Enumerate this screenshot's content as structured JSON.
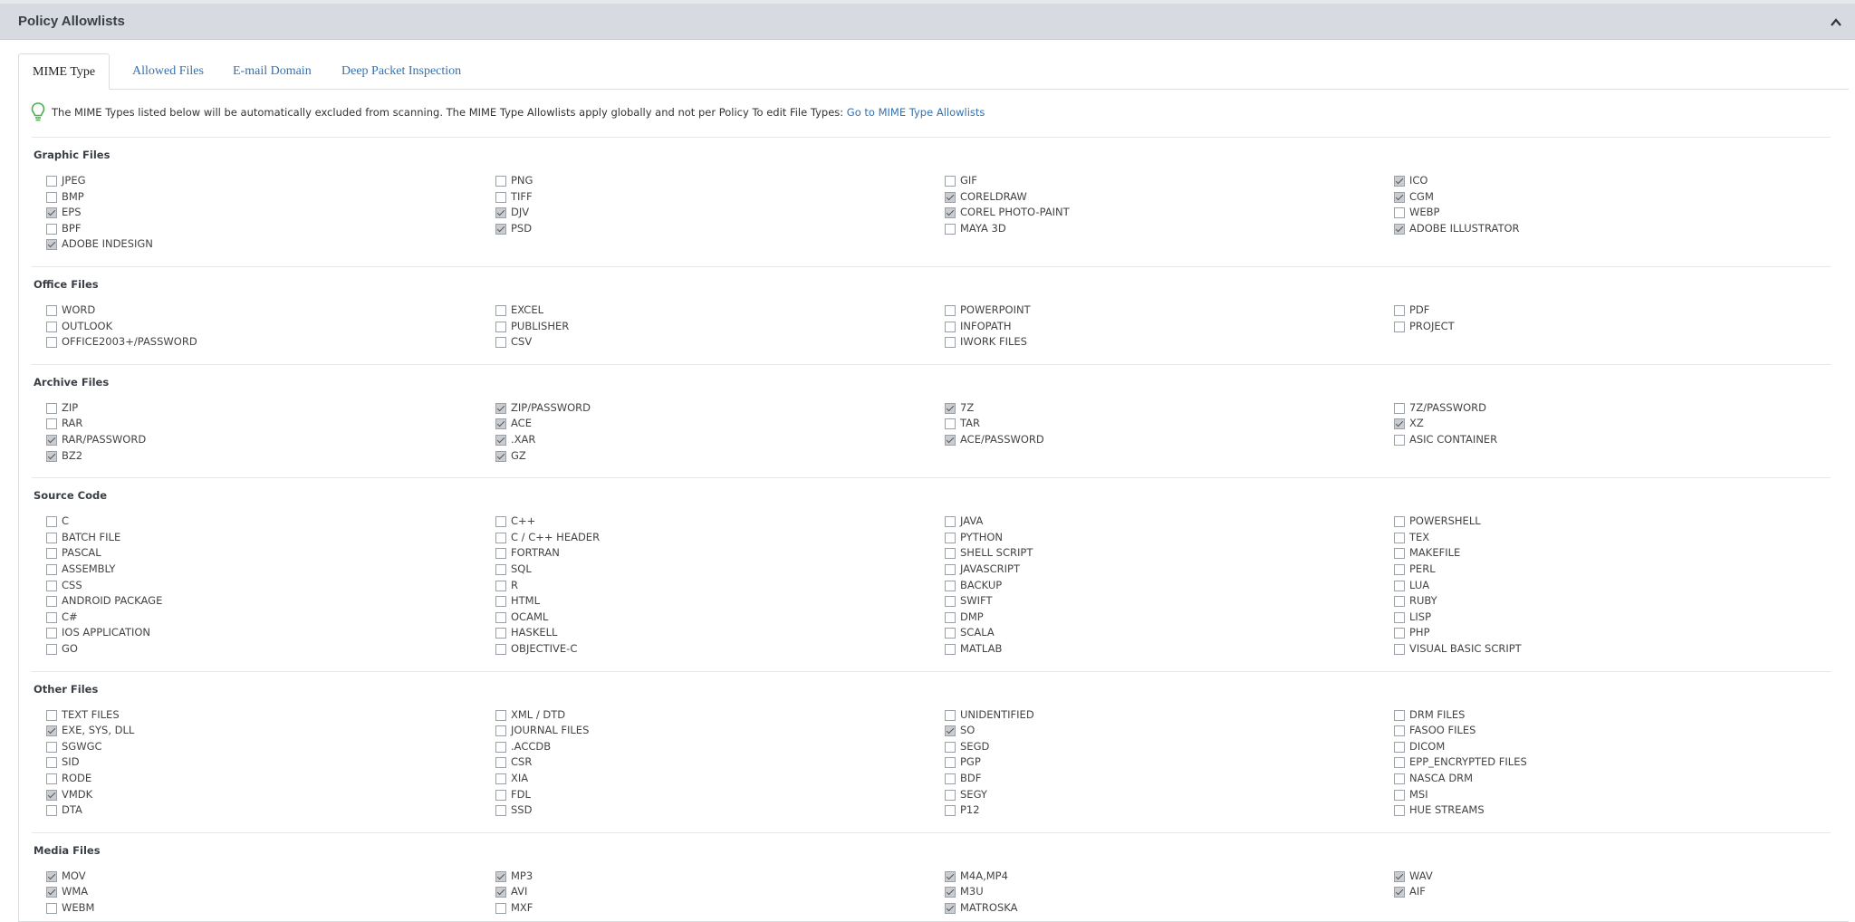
{
  "header": {
    "title": "Policy Allowlists",
    "collapse_icon": "chevron-up-icon"
  },
  "tabs": [
    "MIME Type",
    "Allowed Files",
    "E-mail Domain",
    "Deep Packet Inspection"
  ],
  "info": {
    "text": "The MIME Types listed below will be automatically excluded from scanning. The MIME Type Allowlists apply globally and not per Policy To edit File Types: ",
    "link": "Go to MIME Type Allowlists",
    "icon": "lightbulb-icon"
  },
  "sections": [
    {
      "title": "Graphic Files",
      "items": [
        {
          "label": "JPEG",
          "checked": false
        },
        {
          "label": "PNG",
          "checked": false
        },
        {
          "label": "GIF",
          "checked": false
        },
        {
          "label": "ICO",
          "checked": true
        },
        {
          "label": "BMP",
          "checked": false
        },
        {
          "label": "TIFF",
          "checked": false
        },
        {
          "label": "CORELDRAW",
          "checked": true
        },
        {
          "label": "CGM",
          "checked": true
        },
        {
          "label": "EPS",
          "checked": true
        },
        {
          "label": "DJV",
          "checked": true
        },
        {
          "label": "COREL PHOTO-PAINT",
          "checked": true
        },
        {
          "label": "WEBP",
          "checked": false
        },
        {
          "label": "BPF",
          "checked": false
        },
        {
          "label": "PSD",
          "checked": true
        },
        {
          "label": "MAYA 3D",
          "checked": false
        },
        {
          "label": "ADOBE ILLUSTRATOR",
          "checked": true
        },
        {
          "label": "ADOBE INDESIGN",
          "checked": true
        }
      ]
    },
    {
      "title": "Office Files",
      "items": [
        {
          "label": "WORD",
          "checked": false
        },
        {
          "label": "EXCEL",
          "checked": false
        },
        {
          "label": "POWERPOINT",
          "checked": false
        },
        {
          "label": "PDF",
          "checked": false
        },
        {
          "label": "OUTLOOK",
          "checked": false
        },
        {
          "label": "PUBLISHER",
          "checked": false
        },
        {
          "label": "INFOPATH",
          "checked": false
        },
        {
          "label": "PROJECT",
          "checked": false
        },
        {
          "label": "OFFICE2003+/PASSWORD",
          "checked": false
        },
        {
          "label": "CSV",
          "checked": false
        },
        {
          "label": "IWORK FILES",
          "checked": false
        }
      ]
    },
    {
      "title": "Archive Files",
      "items": [
        {
          "label": "ZIP",
          "checked": false
        },
        {
          "label": "ZIP/PASSWORD",
          "checked": true
        },
        {
          "label": "7Z",
          "checked": true
        },
        {
          "label": "7Z/PASSWORD",
          "checked": false
        },
        {
          "label": "RAR",
          "checked": false
        },
        {
          "label": "ACE",
          "checked": true
        },
        {
          "label": "TAR",
          "checked": false
        },
        {
          "label": "XZ",
          "checked": true
        },
        {
          "label": "RAR/PASSWORD",
          "checked": true
        },
        {
          "label": ".XAR",
          "checked": true
        },
        {
          "label": "ACE/PASSWORD",
          "checked": true
        },
        {
          "label": "ASIC CONTAINER",
          "checked": false
        },
        {
          "label": "BZ2",
          "checked": true
        },
        {
          "label": "GZ",
          "checked": true
        }
      ]
    },
    {
      "title": "Source Code",
      "items": [
        {
          "label": "C",
          "checked": false
        },
        {
          "label": "C++",
          "checked": false
        },
        {
          "label": "JAVA",
          "checked": false
        },
        {
          "label": "POWERSHELL",
          "checked": false
        },
        {
          "label": "BATCH FILE",
          "checked": false
        },
        {
          "label": "C / C++ HEADER",
          "checked": false
        },
        {
          "label": "PYTHON",
          "checked": false
        },
        {
          "label": "TEX",
          "checked": false
        },
        {
          "label": "PASCAL",
          "checked": false
        },
        {
          "label": "FORTRAN",
          "checked": false
        },
        {
          "label": "SHELL SCRIPT",
          "checked": false
        },
        {
          "label": "MAKEFILE",
          "checked": false
        },
        {
          "label": "ASSEMBLY",
          "checked": false
        },
        {
          "label": "SQL",
          "checked": false
        },
        {
          "label": "JAVASCRIPT",
          "checked": false
        },
        {
          "label": "PERL",
          "checked": false
        },
        {
          "label": "CSS",
          "checked": false
        },
        {
          "label": "R",
          "checked": false
        },
        {
          "label": "BACKUP",
          "checked": false
        },
        {
          "label": "LUA",
          "checked": false
        },
        {
          "label": "ANDROID PACKAGE",
          "checked": false
        },
        {
          "label": "HTML",
          "checked": false
        },
        {
          "label": "SWIFT",
          "checked": false
        },
        {
          "label": "RUBY",
          "checked": false
        },
        {
          "label": "C#",
          "checked": false
        },
        {
          "label": "OCAML",
          "checked": false
        },
        {
          "label": "DMP",
          "checked": false
        },
        {
          "label": "LISP",
          "checked": false
        },
        {
          "label": "IOS APPLICATION",
          "checked": false
        },
        {
          "label": "HASKELL",
          "checked": false
        },
        {
          "label": "SCALA",
          "checked": false
        },
        {
          "label": "PHP",
          "checked": false
        },
        {
          "label": "GO",
          "checked": false
        },
        {
          "label": "OBJECTIVE-C",
          "checked": false
        },
        {
          "label": "MATLAB",
          "checked": false
        },
        {
          "label": "VISUAL BASIC SCRIPT",
          "checked": false
        }
      ]
    },
    {
      "title": "Other Files",
      "items": [
        {
          "label": "TEXT FILES",
          "checked": false
        },
        {
          "label": "XML / DTD",
          "checked": false
        },
        {
          "label": "UNIDENTIFIED",
          "checked": false
        },
        {
          "label": "DRM FILES",
          "checked": false
        },
        {
          "label": "EXE, SYS, DLL",
          "checked": true
        },
        {
          "label": "JOURNAL FILES",
          "checked": false
        },
        {
          "label": "SO",
          "checked": true
        },
        {
          "label": "FASOO FILES",
          "checked": false
        },
        {
          "label": "SGWGC",
          "checked": false
        },
        {
          "label": ".ACCDB",
          "checked": false
        },
        {
          "label": "SEGD",
          "checked": false
        },
        {
          "label": "DICOM",
          "checked": false
        },
        {
          "label": "SID",
          "checked": false
        },
        {
          "label": "CSR",
          "checked": false
        },
        {
          "label": "PGP",
          "checked": false
        },
        {
          "label": "EPP_ENCRYPTED FILES",
          "checked": false
        },
        {
          "label": "RODE",
          "checked": false
        },
        {
          "label": "XIA",
          "checked": false
        },
        {
          "label": "BDF",
          "checked": false
        },
        {
          "label": "NASCA DRM",
          "checked": false
        },
        {
          "label": "VMDK",
          "checked": true
        },
        {
          "label": "FDL",
          "checked": false
        },
        {
          "label": "SEGY",
          "checked": false
        },
        {
          "label": "MSI",
          "checked": false
        },
        {
          "label": "DTA",
          "checked": false
        },
        {
          "label": "SSD",
          "checked": false
        },
        {
          "label": "P12",
          "checked": false
        },
        {
          "label": "HUE STREAMS",
          "checked": false
        }
      ]
    },
    {
      "title": "Media Files",
      "items": [
        {
          "label": "MOV",
          "checked": true
        },
        {
          "label": "MP3",
          "checked": true
        },
        {
          "label": "M4A,MP4",
          "checked": true
        },
        {
          "label": "WAV",
          "checked": true
        },
        {
          "label": "WMA",
          "checked": true
        },
        {
          "label": "AVI",
          "checked": true
        },
        {
          "label": "M3U",
          "checked": true
        },
        {
          "label": "AIF",
          "checked": true
        },
        {
          "label": "WEBM",
          "checked": false
        },
        {
          "label": "MXF",
          "checked": false
        },
        {
          "label": "MATROSKA",
          "checked": true
        }
      ]
    }
  ]
}
